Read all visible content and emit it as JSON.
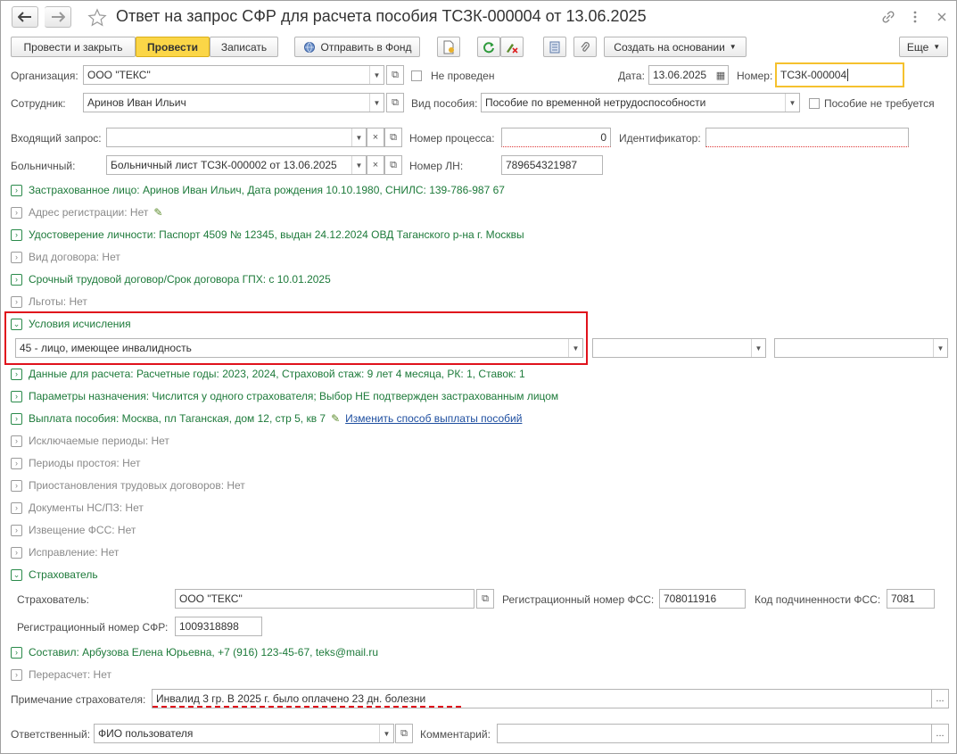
{
  "window": {
    "title": "Ответ на запрос СФР для расчета пособия ТСЗК-000004 от 13.06.2025"
  },
  "toolbar": {
    "post_close": "Провести и закрыть",
    "post": "Провести",
    "save": "Записать",
    "send_fund": "Отправить в Фонд",
    "create_based": "Создать на основании",
    "more": "Еще"
  },
  "header": {
    "org_label": "Организация:",
    "org_value": "ООО \"ТЕКС\"",
    "not_posted": "Не проведен",
    "date_label": "Дата:",
    "date_value": "13.06.2025",
    "number_label": "Номер:",
    "number_value": "ТСЗК-000004",
    "employee_label": "Сотрудник:",
    "employee_value": "Аринов Иван Ильич",
    "benefit_type_label": "Вид пособия:",
    "benefit_type_value": "Пособие по временной нетрудоспособности",
    "benefit_not_required": "Пособие не требуется",
    "incoming_label": "Входящий запрос:",
    "incoming_value": "",
    "process_num_label": "Номер процесса:",
    "process_num_value": "0",
    "identifier_label": "Идентификатор:",
    "identifier_value": "",
    "sick_label": "Больничный:",
    "sick_value": "Больничный лист ТСЗК-000002 от 13.06.2025",
    "ln_label": "Номер ЛН:",
    "ln_value": "789654321987"
  },
  "groups": {
    "insured": "Застрахованное лицо: Аринов Иван Ильич, Дата рождения 10.10.1980, СНИЛС: 139-786-987 67",
    "address": "Адрес регистрации: Нет",
    "identity": "Удостоверение личности: Паспорт 4509 № 12345, выдан 24.12.2024 ОВД Таганского р-на г. Москвы",
    "contract_type": "Вид договора: Нет",
    "contract": "Срочный трудовой договор/Срок договора ГПХ: с 10.01.2025",
    "benefits": "Льготы: Нет",
    "calc_conditions": "Условия исчисления",
    "calc_value1": "45 - лицо, имеющее инвалидность",
    "calc_value2": "",
    "calc_value3": "",
    "calc_data": "Данные для расчета: Расчетные годы: 2023, 2024, Страховой стаж: 9 лет 4 месяца, РК: 1, Ставок: 1",
    "params": "Параметры назначения: Числится у одного страхователя; Выбор НЕ подтвержден застрахованным лицом",
    "payment": "Выплата пособия: Москва, пл Таганская, дом 12, стр 5, кв 7",
    "payment_link": "Изменить способ выплаты пособий",
    "excluded": "Исключаемые периоды: Нет",
    "downtime": "Периоды простоя: Нет",
    "suspension": "Приостановления трудовых договоров: Нет",
    "docs": "Документы НС/ПЗ: Нет",
    "fss_notice": "Извещение ФСС: Нет",
    "correction": "Исправление: Нет",
    "insurer": "Страхователь",
    "compiled": "Составил: Арбузова Елена Юрьевна, +7 (916) 123-45-67, teks@mail.ru",
    "recalc": "Перерасчет: Нет"
  },
  "insurer": {
    "label": "Страхователь:",
    "value": "ООО \"ТЕКС\"",
    "fss_reg_label": "Регистрационный номер ФСС:",
    "fss_reg_value": "708011916",
    "fss_sub_label": "Код подчиненности ФСС:",
    "fss_sub_value": "7081",
    "sfr_reg_label": "Регистрационный номер СФР:",
    "sfr_reg_value": "1009318898"
  },
  "footer": {
    "note_label": "Примечание страхователя:",
    "note_value": "Инвалид 3 гр. В 2025 г. было оплачено 23 дн. болезни",
    "resp_label": "Ответственный:",
    "resp_value": "ФИО пользователя",
    "comment_label": "Комментарий:",
    "comment_value": ""
  },
  "colors": {
    "accent": "#fbd647",
    "group_green": "#1d7a3a",
    "link": "#1f4fa0",
    "highlight": "#e0121c"
  }
}
